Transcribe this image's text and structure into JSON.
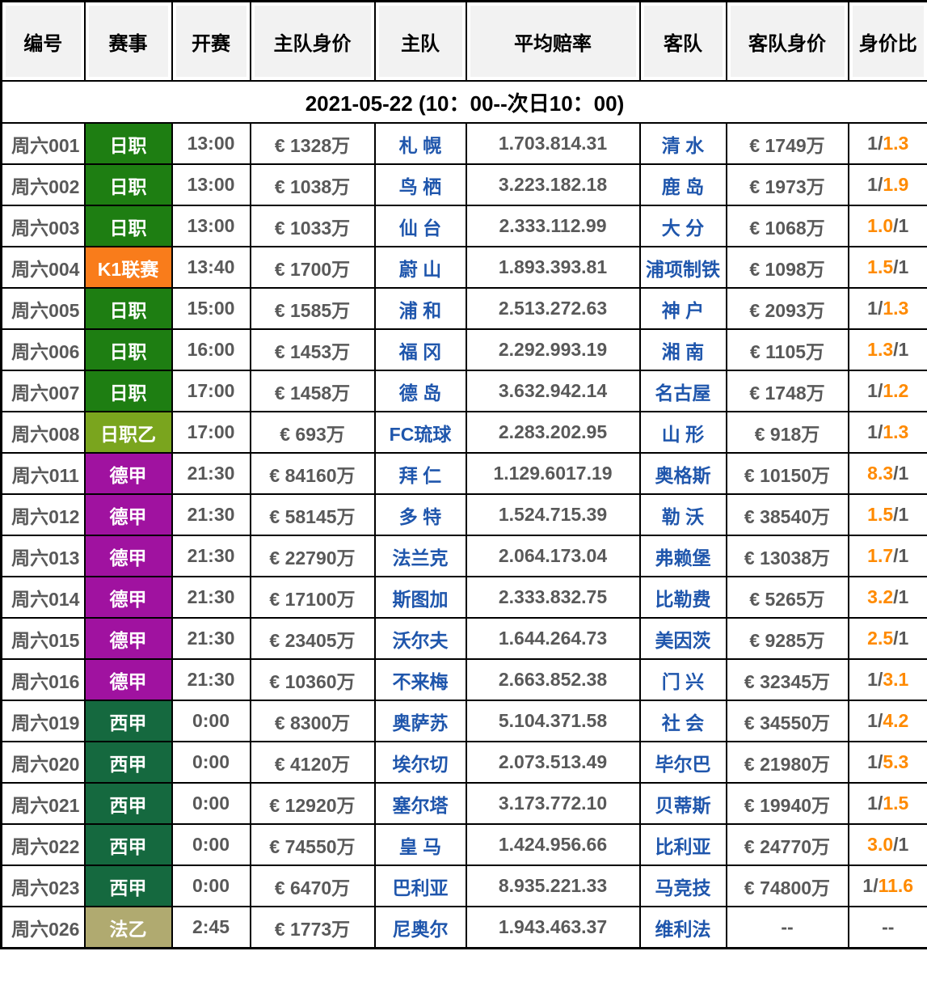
{
  "colors": {
    "text_gray": "#595959",
    "team_blue": "#1f56ac",
    "ratio_orange": "#ff8a00",
    "header_bg": "#f2f2f2",
    "leagues": {
      "日职": "#1e7e12",
      "K1联赛": "#f97c1b",
      "日职乙": "#7aa51e",
      "德甲": "#a012a0",
      "西甲": "#15693f",
      "法乙": "#b0aa70"
    }
  },
  "table": {
    "columns": [
      "编号",
      "赛事",
      "开赛",
      "主队身价",
      "主队",
      "平均赔率",
      "客队",
      "客队身价",
      "身价比"
    ],
    "date_banner": "2021-05-22 (10：00--次日10：00)",
    "rows": [
      {
        "id": "周六001",
        "league": "日职",
        "time": "13:00",
        "home_value": "€ 1328万",
        "home": "札 幌",
        "odds": "1.703.814.31",
        "away": "清 水",
        "away_value": "€ 1749万",
        "ratio": [
          {
            "text": "1/",
            "color": "gray"
          },
          {
            "text": "1.3",
            "color": "orange"
          }
        ]
      },
      {
        "id": "周六002",
        "league": "日职",
        "time": "13:00",
        "home_value": "€ 1038万",
        "home": "鸟 栖",
        "odds": "3.223.182.18",
        "away": "鹿 岛",
        "away_value": "€ 1973万",
        "ratio": [
          {
            "text": "1/",
            "color": "gray"
          },
          {
            "text": "1.9",
            "color": "orange"
          }
        ]
      },
      {
        "id": "周六003",
        "league": "日职",
        "time": "13:00",
        "home_value": "€ 1033万",
        "home": "仙 台",
        "odds": "2.333.112.99",
        "away": "大 分",
        "away_value": "€ 1068万",
        "ratio": [
          {
            "text": "1.0",
            "color": "orange"
          },
          {
            "text": "/1",
            "color": "gray"
          }
        ]
      },
      {
        "id": "周六004",
        "league": "K1联赛",
        "time": "13:40",
        "home_value": "€ 1700万",
        "home": "蔚 山",
        "odds": "1.893.393.81",
        "away": "浦项制铁",
        "away_value": "€ 1098万",
        "ratio": [
          {
            "text": "1.5",
            "color": "orange"
          },
          {
            "text": "/1",
            "color": "gray"
          }
        ]
      },
      {
        "id": "周六005",
        "league": "日职",
        "time": "15:00",
        "home_value": "€ 1585万",
        "home": "浦 和",
        "odds": "2.513.272.63",
        "away": "神 户",
        "away_value": "€ 2093万",
        "ratio": [
          {
            "text": "1/",
            "color": "gray"
          },
          {
            "text": "1.3",
            "color": "orange"
          }
        ]
      },
      {
        "id": "周六006",
        "league": "日职",
        "time": "16:00",
        "home_value": "€ 1453万",
        "home": "福 冈",
        "odds": "2.292.993.19",
        "away": "湘 南",
        "away_value": "€ 1105万",
        "ratio": [
          {
            "text": "1.3",
            "color": "orange"
          },
          {
            "text": "/1",
            "color": "gray"
          }
        ]
      },
      {
        "id": "周六007",
        "league": "日职",
        "time": "17:00",
        "home_value": "€ 1458万",
        "home": "德 岛",
        "odds": "3.632.942.14",
        "away": "名古屋",
        "away_value": "€ 1748万",
        "ratio": [
          {
            "text": "1/",
            "color": "gray"
          },
          {
            "text": "1.2",
            "color": "orange"
          }
        ]
      },
      {
        "id": "周六008",
        "league": "日职乙",
        "time": "17:00",
        "home_value": "€ 693万",
        "home": "FC琉球",
        "odds": "2.283.202.95",
        "away": "山 形",
        "away_value": "€ 918万",
        "ratio": [
          {
            "text": "1/",
            "color": "gray"
          },
          {
            "text": "1.3",
            "color": "orange"
          }
        ]
      },
      {
        "id": "周六011",
        "league": "德甲",
        "time": "21:30",
        "home_value": "€ 84160万",
        "home": "拜 仁",
        "odds": "1.129.6017.19",
        "away": "奥格斯",
        "away_value": "€ 10150万",
        "ratio": [
          {
            "text": "8.3",
            "color": "orange"
          },
          {
            "text": "/1",
            "color": "gray"
          }
        ]
      },
      {
        "id": "周六012",
        "league": "德甲",
        "time": "21:30",
        "home_value": "€ 58145万",
        "home": "多 特",
        "odds": "1.524.715.39",
        "away": "勒 沃",
        "away_value": "€ 38540万",
        "ratio": [
          {
            "text": "1.5",
            "color": "orange"
          },
          {
            "text": "/1",
            "color": "gray"
          }
        ]
      },
      {
        "id": "周六013",
        "league": "德甲",
        "time": "21:30",
        "home_value": "€ 22790万",
        "home": "法兰克",
        "odds": "2.064.173.04",
        "away": "弗赖堡",
        "away_value": "€ 13038万",
        "ratio": [
          {
            "text": "1.7",
            "color": "orange"
          },
          {
            "text": "/1",
            "color": "gray"
          }
        ]
      },
      {
        "id": "周六014",
        "league": "德甲",
        "time": "21:30",
        "home_value": "€ 17100万",
        "home": "斯图加",
        "odds": "2.333.832.75",
        "away": "比勒费",
        "away_value": "€ 5265万",
        "ratio": [
          {
            "text": "3.2",
            "color": "orange"
          },
          {
            "text": "/1",
            "color": "gray"
          }
        ]
      },
      {
        "id": "周六015",
        "league": "德甲",
        "time": "21:30",
        "home_value": "€ 23405万",
        "home": "沃尔夫",
        "odds": "1.644.264.73",
        "away": "美因茨",
        "away_value": "€ 9285万",
        "ratio": [
          {
            "text": "2.5",
            "color": "orange"
          },
          {
            "text": "/1",
            "color": "gray"
          }
        ]
      },
      {
        "id": "周六016",
        "league": "德甲",
        "time": "21:30",
        "home_value": "€ 10360万",
        "home": "不来梅",
        "odds": "2.663.852.38",
        "away": "门 兴",
        "away_value": "€ 32345万",
        "ratio": [
          {
            "text": "1/",
            "color": "gray"
          },
          {
            "text": "3.1",
            "color": "orange"
          }
        ]
      },
      {
        "id": "周六019",
        "league": "西甲",
        "time": "0:00",
        "home_value": "€ 8300万",
        "home": "奥萨苏",
        "odds": "5.104.371.58",
        "away": "社 会",
        "away_value": "€ 34550万",
        "ratio": [
          {
            "text": "1/",
            "color": "gray"
          },
          {
            "text": "4.2",
            "color": "orange"
          }
        ]
      },
      {
        "id": "周六020",
        "league": "西甲",
        "time": "0:00",
        "home_value": "€ 4120万",
        "home": "埃尔切",
        "odds": "2.073.513.49",
        "away": "毕尔巴",
        "away_value": "€ 21980万",
        "ratio": [
          {
            "text": "1/",
            "color": "gray"
          },
          {
            "text": "5.3",
            "color": "orange"
          }
        ]
      },
      {
        "id": "周六021",
        "league": "西甲",
        "time": "0:00",
        "home_value": "€ 12920万",
        "home": "塞尔塔",
        "odds": "3.173.772.10",
        "away": "贝蒂斯",
        "away_value": "€ 19940万",
        "ratio": [
          {
            "text": "1/",
            "color": "gray"
          },
          {
            "text": "1.5",
            "color": "orange"
          }
        ]
      },
      {
        "id": "周六022",
        "league": "西甲",
        "time": "0:00",
        "home_value": "€ 74550万",
        "home": "皇 马",
        "odds": "1.424.956.66",
        "away": "比利亚",
        "away_value": "€ 24770万",
        "ratio": [
          {
            "text": "3.0",
            "color": "orange"
          },
          {
            "text": "/1",
            "color": "gray"
          }
        ]
      },
      {
        "id": "周六023",
        "league": "西甲",
        "time": "0:00",
        "home_value": "€ 6470万",
        "home": "巴利亚",
        "odds": "8.935.221.33",
        "away": "马竞技",
        "away_value": "€ 74800万",
        "ratio": [
          {
            "text": "1/",
            "color": "gray"
          },
          {
            "text": "11.6",
            "color": "orange"
          }
        ]
      },
      {
        "id": "周六026",
        "league": "法乙",
        "time": "2:45",
        "home_value": "€ 1773万",
        "home": "尼奥尔",
        "odds": "1.943.463.37",
        "away": "维利法",
        "away_value": "--",
        "ratio": [
          {
            "text": "--",
            "color": "gray"
          }
        ]
      }
    ]
  }
}
